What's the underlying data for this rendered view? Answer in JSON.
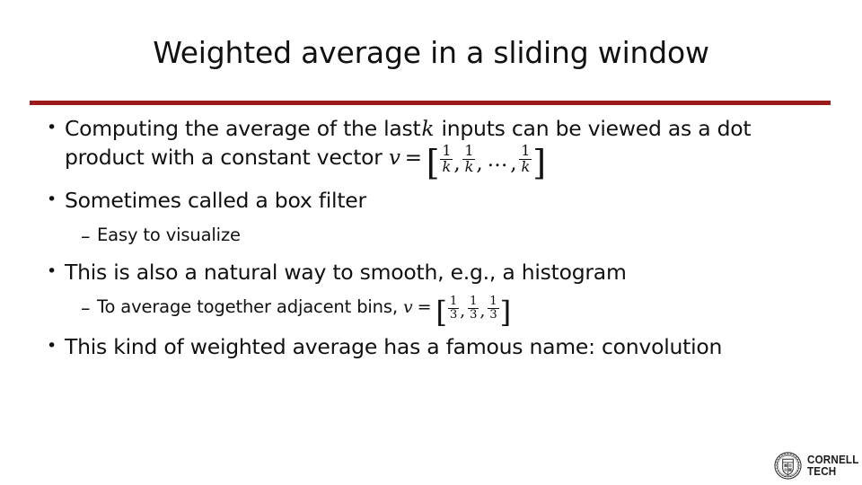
{
  "slide": {
    "title": "Weighted average in a sliding window",
    "accent_color": "#9B1A1A",
    "background_color": "#FFFFFF",
    "text_color": "#111111"
  },
  "bullets": {
    "b1_part1": "Computing the average of the last",
    "b1_var_k": "k",
    "b1_part2": "inputs can be viewed as a dot product with a constant vector",
    "b1_math": {
      "lhs": "v",
      "equals": "=",
      "open": "[",
      "close": "]",
      "numerator": "1",
      "denominator": "k",
      "comma": ",",
      "ellipsis": "…"
    },
    "b2": "Sometimes called a box filter",
    "b2_sub": "Easy to visualize",
    "b3": "This is also a natural way to smooth, e.g., a histogram",
    "b3_sub_text": "To average together adjacent bins,",
    "b3_sub_math": {
      "lhs": "v",
      "equals": "=",
      "open": "[",
      "close": "]",
      "numerator": "1",
      "denominator": "3",
      "comma": ","
    },
    "b4": "This kind of weighted average has a famous name: convolution"
  },
  "markers": {
    "dot": "•",
    "dash": "–"
  },
  "logo": {
    "line1": "CORNELL",
    "line2": "TECH",
    "seal_name": "cornell-seal"
  }
}
